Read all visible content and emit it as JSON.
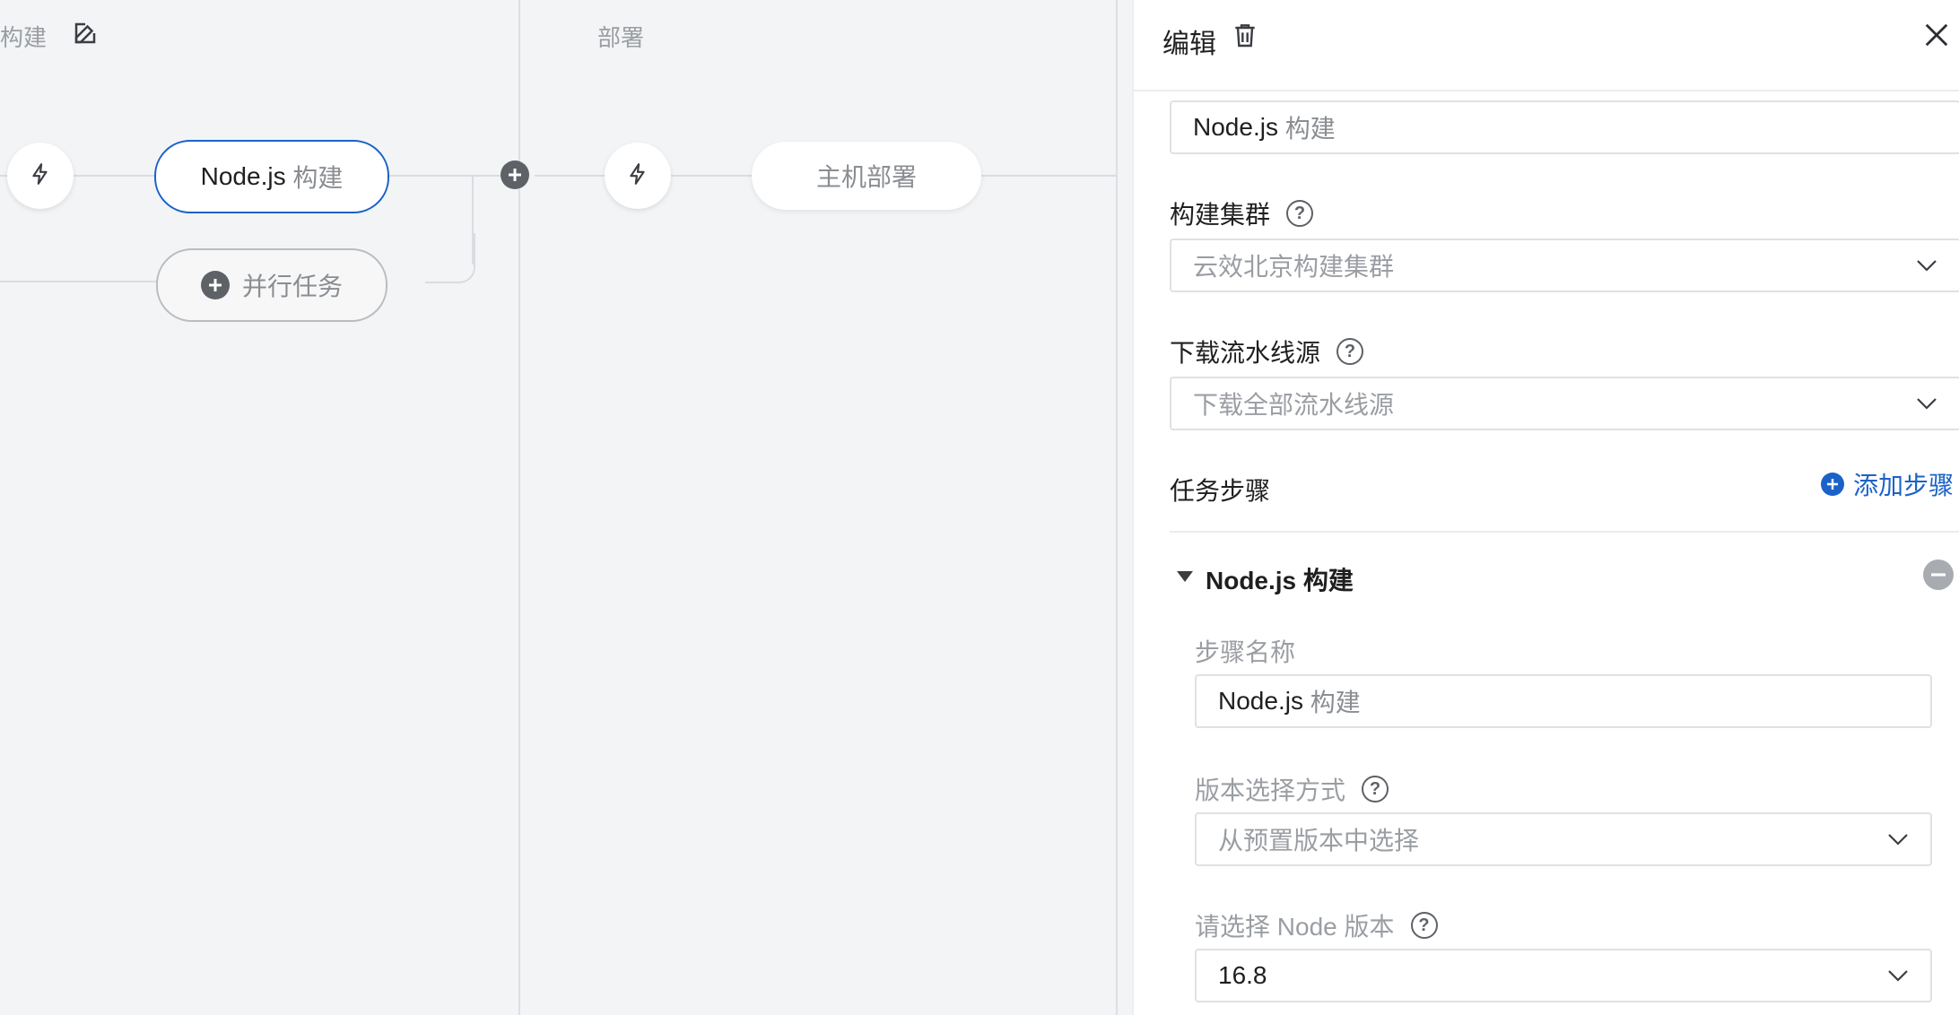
{
  "canvas": {
    "stage_build": {
      "title": "构建"
    },
    "stage_deploy": {
      "title": "部署"
    },
    "build_job": {
      "name": "Node.js",
      "suffix": "构建"
    },
    "parallel": {
      "label": "并行任务"
    },
    "deploy_job": {
      "name": "主机部署"
    }
  },
  "panel": {
    "header": {
      "title": "编辑"
    },
    "job_name": {
      "value_main": "Node.js",
      "value_suffix": "构建"
    },
    "build_cluster": {
      "label": "构建集群",
      "placeholder": "云效北京构建集群"
    },
    "download_source": {
      "label": "下载流水线源",
      "placeholder": "下载全部流水线源"
    },
    "steps": {
      "label": "任务步骤",
      "add_label": "添加步骤",
      "step": {
        "title": "Node.js 构建",
        "name_label": "步骤名称",
        "name_value_main": "Node.js",
        "name_value_suffix": "构建",
        "version_mode_label": "版本选择方式",
        "version_mode_value": "从预置版本中选择",
        "node_version_label": "请选择 Node 版本",
        "node_version_value": "16.8"
      }
    }
  },
  "colors": {
    "accent": "#1b62c8",
    "divider": "#dcdfe3",
    "muted": "#8a8d92"
  },
  "icons": [
    "edit-icon",
    "lightning-icon",
    "plus-circle-icon",
    "trash-icon",
    "close-icon",
    "help-icon",
    "chevron-down-icon",
    "caret-down-icon",
    "minus-circle-icon"
  ]
}
